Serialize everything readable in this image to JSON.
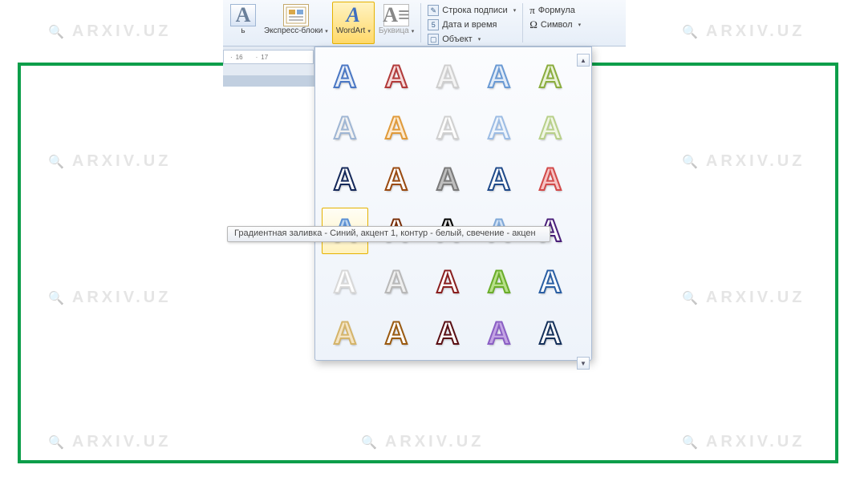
{
  "watermark": "ARXIV.UZ",
  "ribbon": {
    "textbox_suffix": "ь",
    "quickparts": "Экспресс-блоки",
    "wordart": "WordArt",
    "dropcap": "Буквица",
    "signature": "Строка подписи",
    "datetime": "Дата и время",
    "object": "Объект",
    "equation": "Формула",
    "symbol": "Символ"
  },
  "ruler": {
    "m16": "16",
    "m17": "17"
  },
  "tooltip": "Градиентная заливка - Синий, акцент 1, контур - белый, свечение - акцен",
  "gallery": {
    "letter": "A",
    "selected_index": 15,
    "styles": [
      {
        "fill": "#e8eef7",
        "stroke": "#4a77c4"
      },
      {
        "fill": "#f6dada",
        "stroke": "#b23a3a"
      },
      {
        "fill": "#f4f4f4",
        "stroke": "#cfcfcf"
      },
      {
        "fill": "#e2ecf8",
        "stroke": "#6a9ad4"
      },
      {
        "fill": "#eaf2d8",
        "stroke": "#8aad3e"
      },
      {
        "fill": "#f2f2f2",
        "stroke": "#9fb6d4"
      },
      {
        "fill": "#fce9cf",
        "stroke": "#e09a3a"
      },
      {
        "fill": "#fdfdfd",
        "stroke": "#d0d0d0"
      },
      {
        "fill": "#eef4fb",
        "stroke": "#9cbce4"
      },
      {
        "fill": "#f0f6e4",
        "stroke": "#b8d08a"
      },
      {
        "fill": "#2a4f9a",
        "stroke": "#14285a",
        "tc": "#fff"
      },
      {
        "fill": "#e07a2a",
        "stroke": "#9a4a10",
        "tc": "#fff"
      },
      {
        "fill": "#bfbfbf",
        "stroke": "#7a7a7a"
      },
      {
        "fill": "#3a6fbf",
        "stroke": "#1f4a8a",
        "tc": "#fff"
      },
      {
        "fill": "#f6c4c4",
        "stroke": "#d24a4a"
      },
      {
        "fill": "#bcd4ef",
        "stroke": "#5a8fd4"
      },
      {
        "fill": "#c4551a",
        "stroke": "#7a2f08",
        "tc": "#fff"
      },
      {
        "fill": "#2a2a2a",
        "stroke": "#000",
        "tc": "#e0e0e0"
      },
      {
        "fill": "#cfe0f4",
        "stroke": "#7fa8d8"
      },
      {
        "fill": "#7a3fbf",
        "stroke": "#4a1f7a",
        "tc": "#fff"
      },
      {
        "fill": "#fdfdfd",
        "stroke": "#d8d8d8"
      },
      {
        "fill": "#efefef",
        "stroke": "#b8b8b8"
      },
      {
        "fill": "#d24a4a",
        "stroke": "#8a1f1f",
        "tc": "#fff"
      },
      {
        "fill": "#b8e08a",
        "stroke": "#6aad2a"
      },
      {
        "fill": "#5a8fd4",
        "stroke": "#2a5fa4",
        "tc": "#fff"
      },
      {
        "fill": "#f4e4c4",
        "stroke": "#d4b46a"
      },
      {
        "fill": "#e09a3a",
        "stroke": "#9a5a10",
        "tc": "#fff"
      },
      {
        "fill": "#9a1f2a",
        "stroke": "#5a0f14",
        "tc": "#fff"
      },
      {
        "fill": "#c4a4e4",
        "stroke": "#8a5fc4"
      },
      {
        "fill": "#2a5fa4",
        "stroke": "#14305a",
        "tc": "#fff"
      }
    ]
  }
}
